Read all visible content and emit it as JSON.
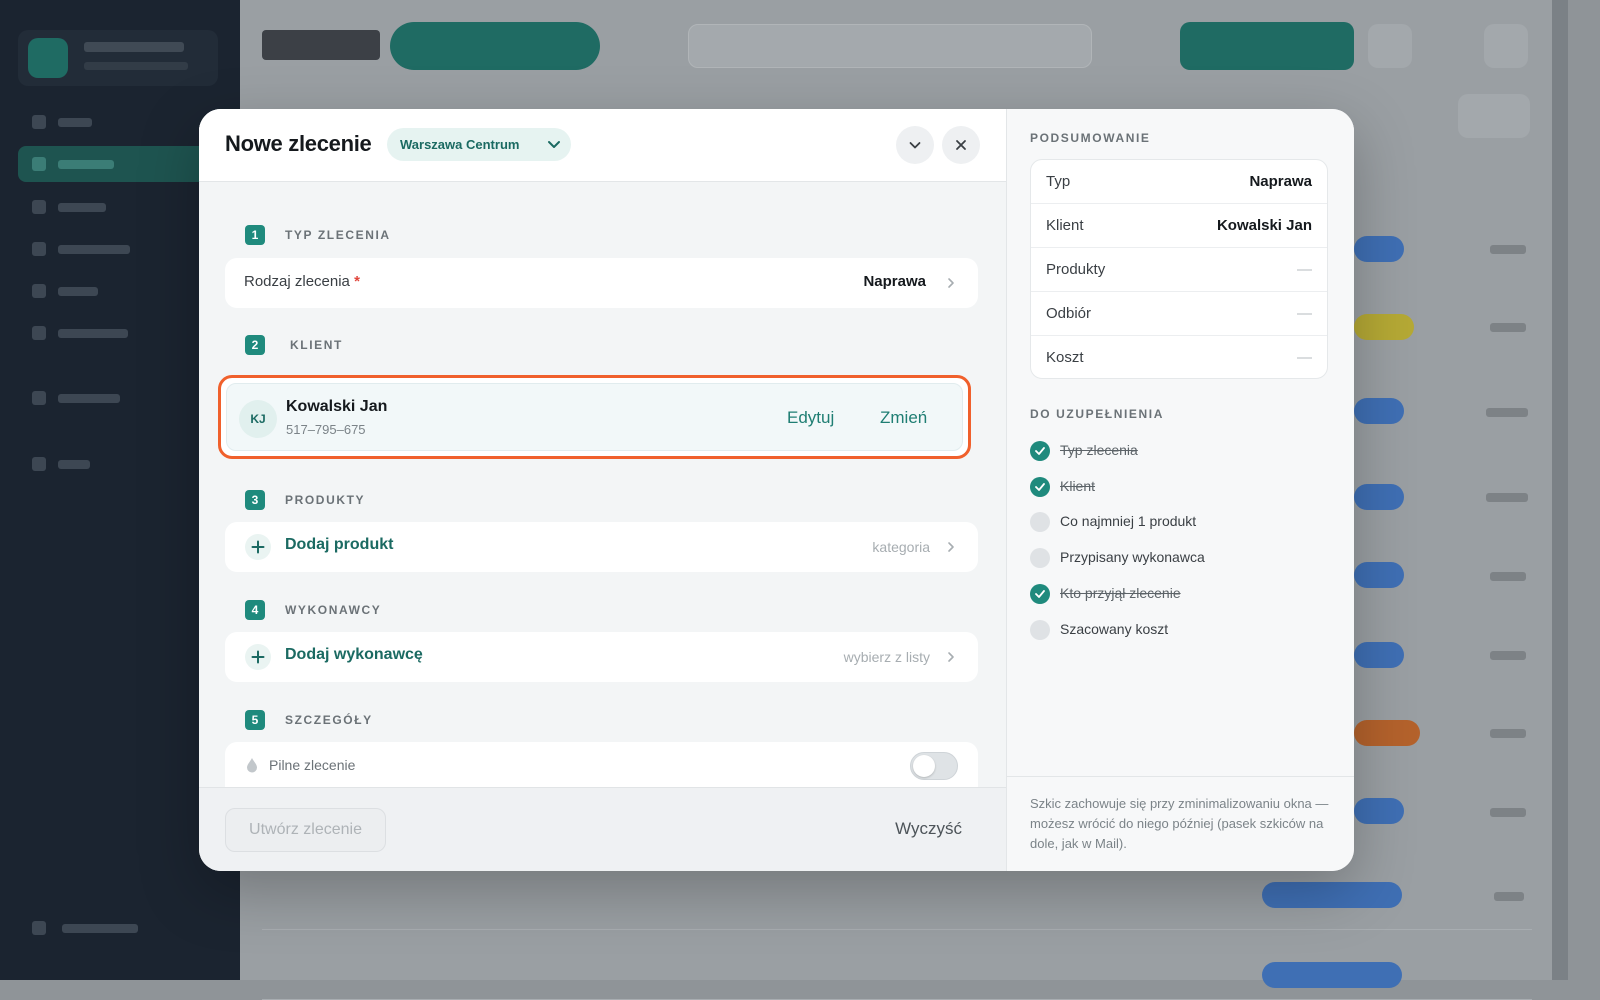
{
  "modal": {
    "title": "Nowe zlecenie",
    "branch": "Warszawa Centrum"
  },
  "steps": [
    {
      "num": "1",
      "label": "TYP ZLECENIA"
    },
    {
      "num": "2",
      "label": "KLIENT"
    },
    {
      "num": "3",
      "label": "PRODUKTY"
    },
    {
      "num": "4",
      "label": "WYKONAWCY"
    },
    {
      "num": "5",
      "label": "SZCZEGÓŁY"
    }
  ],
  "order_type": {
    "label": "Rodzaj zlecenia",
    "required_mark": "*",
    "value": "Naprawa"
  },
  "client": {
    "initials": "KJ",
    "name": "Kowalski Jan",
    "phone": "517–795–675",
    "edit": "Edytuj",
    "change": "Zmień"
  },
  "products": {
    "add_label": "Dodaj produkt",
    "hint": "kategoria"
  },
  "executors": {
    "add_label": "Dodaj wykonawcę",
    "hint": "wybierz z listy"
  },
  "details": {
    "urgent_label": "Pilne zlecenie",
    "urgent_on": false
  },
  "footer": {
    "create": "Utwórz zlecenie",
    "clear": "Wyczyść"
  },
  "summary": {
    "title": "PODSUMOWANIE",
    "rows": [
      {
        "key": "Typ",
        "value": "Naprawa"
      },
      {
        "key": "Klient",
        "value": "Kowalski Jan"
      },
      {
        "key": "Produkty",
        "value": "—"
      },
      {
        "key": "Odbiór",
        "value": "—"
      },
      {
        "key": "Koszt",
        "value": "—"
      }
    ],
    "todo_title": "DO UZUPEŁNIENIA",
    "todo": [
      {
        "label": "Typ zlecenia",
        "done": true
      },
      {
        "label": "Klient",
        "done": true
      },
      {
        "label": "Co najmniej 1 produkt",
        "done": false
      },
      {
        "label": "Przypisany wykonawca",
        "done": false
      },
      {
        "label": "Kto przyjął zlecenie",
        "done": true
      },
      {
        "label": "Szacowany koszt",
        "done": false
      }
    ],
    "note": "Szkic zachowuje się przy zminimalizowaniu okna — możesz wrócić do niego później (pasek szkiców na dole, jak w Mail)."
  },
  "colors": {
    "accent": "#1f8a7d",
    "highlight": "#f0602c",
    "sidebar": "#1b2430"
  },
  "icons": [
    "chevron-down-icon",
    "close-icon",
    "chevron-right-icon",
    "plus-icon",
    "drop-icon",
    "check-icon"
  ]
}
